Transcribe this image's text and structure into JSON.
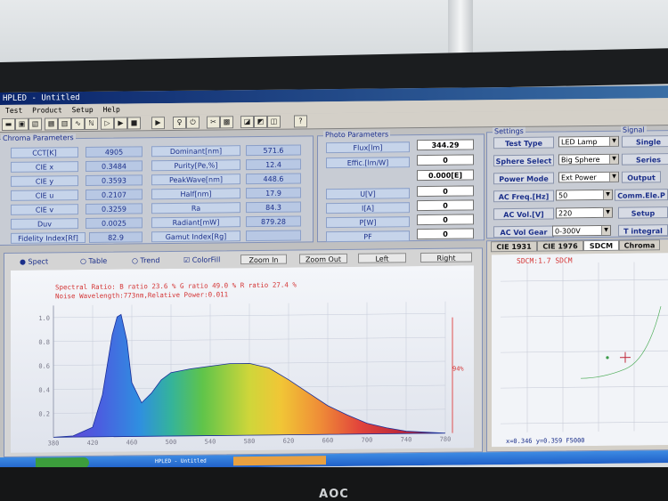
{
  "window": {
    "title": "HPLED - Untitled"
  },
  "menu": [
    "Test",
    "Product",
    "Setup",
    "Help"
  ],
  "chroma": {
    "title": "Chroma Parameters",
    "rows": [
      {
        "label": "CCT[K]",
        "value": "4905"
      },
      {
        "label": "CIE x",
        "value": "0.3484"
      },
      {
        "label": "CIE y",
        "value": "0.3593"
      },
      {
        "label": "CIE u",
        "value": "0.2107"
      },
      {
        "label": "CIE v",
        "value": "0.3259"
      },
      {
        "label": "Duv",
        "value": "0.0025"
      },
      {
        "label": "Fidelity Index[Rf]",
        "value": "82.9"
      }
    ],
    "rows2": [
      {
        "label": "Dominant[nm]",
        "value": "571.6"
      },
      {
        "label": "Purity[Pe,%]",
        "value": "12.4"
      },
      {
        "label": "PeakWave[nm]",
        "value": "448.6"
      },
      {
        "label": "Half[nm]",
        "value": "17.9"
      },
      {
        "label": "Ra",
        "value": "84.3"
      },
      {
        "label": "Radiant[mW]",
        "value": "879.28"
      },
      {
        "label": "Gamut Index[Rg]",
        "value": ""
      }
    ]
  },
  "photo": {
    "title": "Photo Parameters",
    "flux_label": "Flux[lm]",
    "flux": "344.29",
    "effic_label": "Effic.[lm/W]",
    "effic": "0",
    "e_value": "0.000[E]",
    "rows": [
      {
        "label": "U[V]",
        "value": "0"
      },
      {
        "label": "I[A]",
        "value": "0"
      },
      {
        "label": "P[W]",
        "value": "0"
      },
      {
        "label": "PF",
        "value": "0"
      }
    ]
  },
  "settings": {
    "title": "Settings",
    "signal_title": "Signal",
    "rows": [
      {
        "label": "Test Type",
        "value": "LED Lamp",
        "button": "Single"
      },
      {
        "label": "Sphere Select",
        "value": "Big Sphere",
        "button": "Series"
      },
      {
        "label": "Power Mode",
        "value": "Ext Power",
        "button": "Output"
      },
      {
        "label": "AC Freq.[Hz]",
        "value": "50",
        "button": "Comm.Ele.P"
      },
      {
        "label": "AC Vol.[V]",
        "value": "220",
        "button": "Setup"
      },
      {
        "label": "AC Vol Gear",
        "value": "0-300V",
        "button": "T integral"
      }
    ]
  },
  "spectrum": {
    "radios": [
      "Spect",
      "Table",
      "Trend"
    ],
    "colorfill": "ColorFill",
    "buttons": [
      "Zoom In",
      "Zoom Out",
      "Left",
      "Right"
    ],
    "annotation1": "Spectral Ratio: B ratio 23.6 %  G ratio 49.0 %  R ratio 27.4 %",
    "annotation2": "Noise Wavelength:773nm,Relative Power:0.011",
    "marker": "94%"
  },
  "cie_tabs": [
    "CIE 1931",
    "CIE 1976",
    "SDCM",
    "Chroma"
  ],
  "sdcm": {
    "title": "SDCM:1.7 SDCM",
    "readout": "x=0.346 y=0.359 F5000"
  },
  "taskbar": {
    "items": [
      "HPLED - Untitled"
    ]
  },
  "monitor": {
    "brand": "AOC"
  },
  "chart_data": {
    "type": "area",
    "title": "",
    "xlabel": "",
    "ylabel": "",
    "xlim": [
      380,
      780
    ],
    "ylim": [
      0,
      1.1
    ],
    "x_ticks": [
      380,
      420,
      460,
      500,
      540,
      580,
      620,
      660,
      700,
      740,
      780
    ],
    "y_ticks": [
      0.2,
      0.4,
      0.6,
      0.8,
      1.0
    ],
    "x": [
      380,
      400,
      420,
      430,
      440,
      445,
      449,
      455,
      460,
      470,
      480,
      490,
      500,
      520,
      540,
      560,
      580,
      600,
      620,
      640,
      660,
      680,
      700,
      720,
      740,
      760,
      780
    ],
    "y": [
      0,
      0.01,
      0.08,
      0.35,
      0.85,
      1.0,
      1.02,
      0.8,
      0.45,
      0.28,
      0.36,
      0.47,
      0.53,
      0.56,
      0.58,
      0.6,
      0.6,
      0.56,
      0.46,
      0.35,
      0.24,
      0.16,
      0.09,
      0.05,
      0.02,
      0.01,
      0
    ]
  }
}
